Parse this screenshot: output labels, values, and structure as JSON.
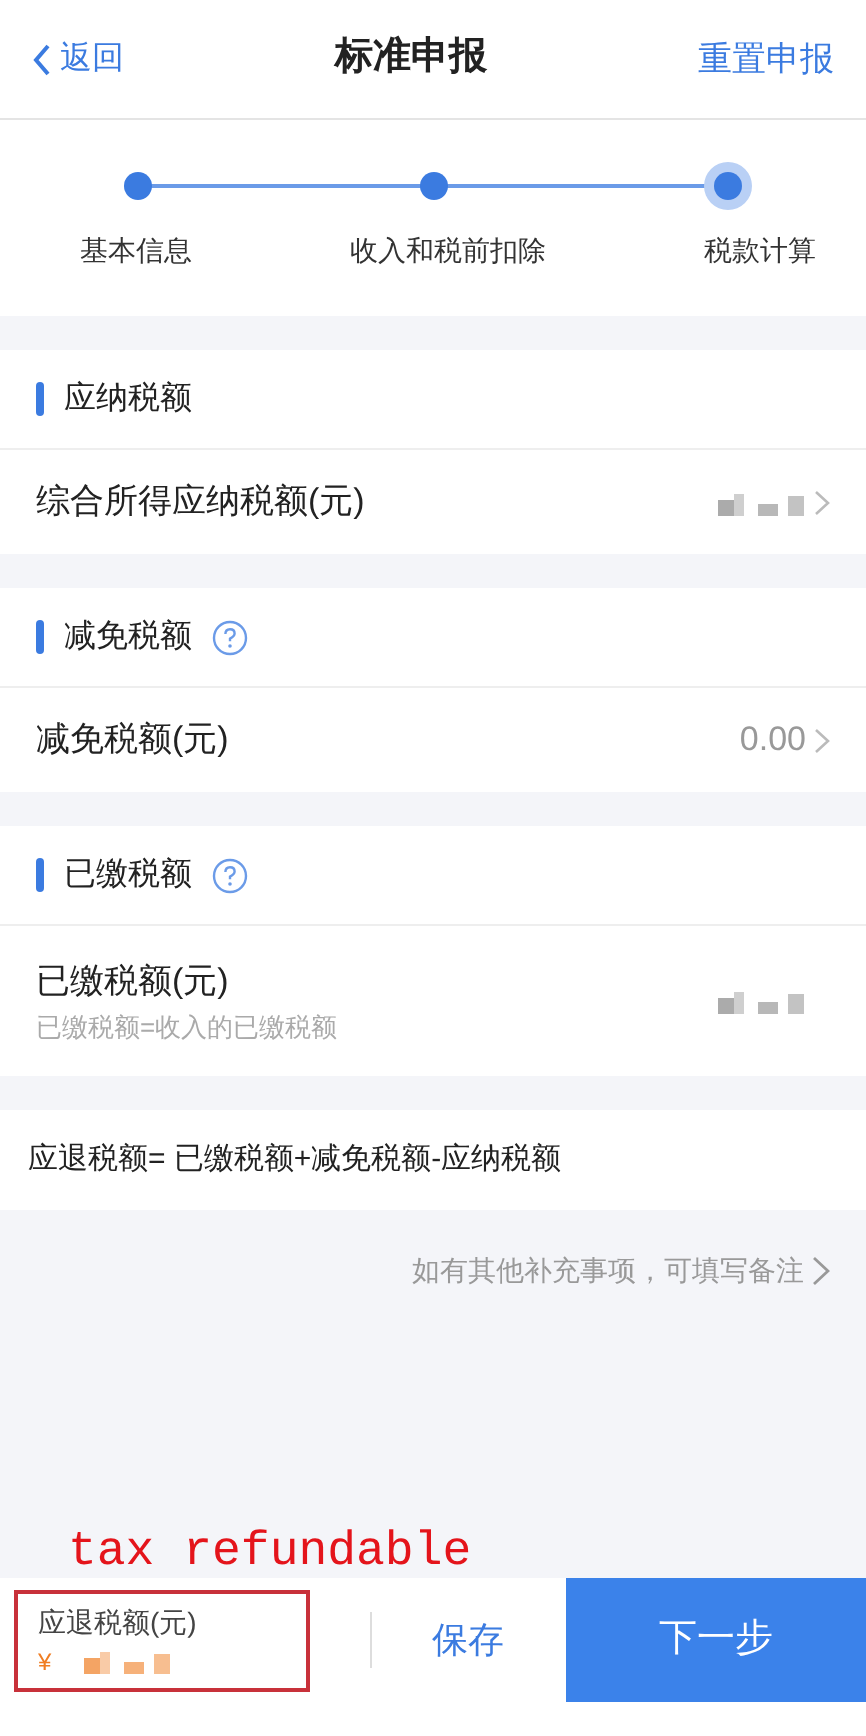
{
  "header": {
    "back": "返回",
    "title": "标准申报",
    "action": "重置申报"
  },
  "steps": [
    {
      "label": "基本信息",
      "current": false
    },
    {
      "label": "收入和税前扣除",
      "current": false
    },
    {
      "label": "税款计算",
      "current": true
    }
  ],
  "sections": [
    {
      "title": "应纳税额",
      "help": false,
      "rows": [
        {
          "label": "综合所得应纳税额(元)",
          "kind": "obscured",
          "chevron": true
        }
      ]
    },
    {
      "title": "减免税额",
      "help": true,
      "rows": [
        {
          "label": "减免税额(元)",
          "kind": "text",
          "value": "0.00",
          "chevron": true
        }
      ]
    },
    {
      "title": "已缴税额",
      "help": true,
      "rows": [
        {
          "label": "已缴税额(元)",
          "note": "已缴税额=收入的已缴税额",
          "kind": "obscured",
          "chevron": false
        }
      ]
    }
  ],
  "formula": "应退税额= 已缴税额+减免税额-应纳税额",
  "remark_link": "如有其他补充事项，可填写备注",
  "annotation": {
    "text": "tax refundable"
  },
  "footer": {
    "refund_label": "应退税额(元)",
    "currency": "¥",
    "highlighted": true,
    "save": "保存",
    "next": "下一步"
  }
}
